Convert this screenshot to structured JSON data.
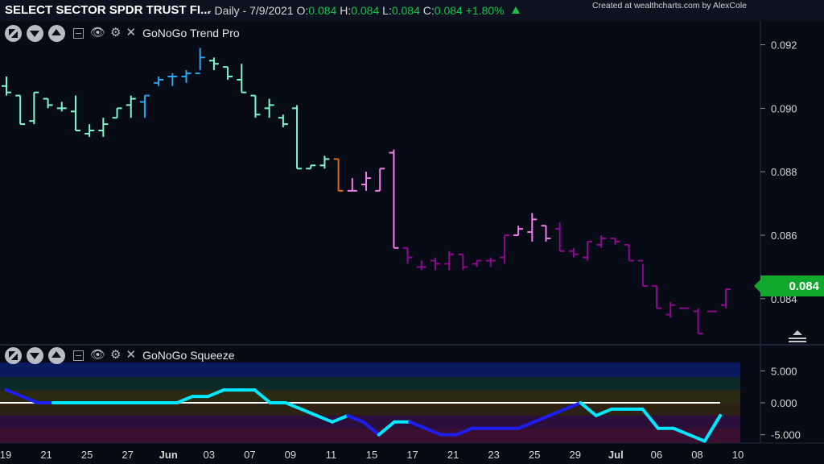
{
  "header": {
    "title": "SELECT SECTOR SPDR TRUST FI...",
    "meta": "- Daily - 7/9/2021",
    "open_label": "O:",
    "open": "0.084",
    "high_label": "H:",
    "high": "0.084",
    "low_label": "L:",
    "low": "0.084",
    "close_label": "C:",
    "close": "0.084",
    "change": "+1.80%",
    "credit": "Created at wealthcharts.com by AlexCole"
  },
  "panels": {
    "price_label": "GoNoGo Trend Pro",
    "oscillator_label": "GoNoGo Squeeze"
  },
  "last_price_tag": "0.084",
  "colors": {
    "go_strong": "#2aa6ee",
    "go": "#7ff7cf",
    "nogo": "#8c0a8f",
    "nogo_weak": "#f07de6",
    "neutral": "#d86a12",
    "squeeze_max": "#1e1ef0",
    "squeeze": "#00e8ff",
    "price_tag": "#11a82c",
    "background": "#070b15"
  },
  "chart_data": [
    {
      "type": "bar",
      "style": "ohlc",
      "title": "GoNoGo Trend Pro",
      "ylim": [
        0.0826,
        0.0927
      ],
      "yticks": [
        "0.092",
        "0.090",
        "0.088",
        "0.086",
        "0.084"
      ],
      "x_tick_labels": [
        "19",
        "21",
        "25",
        "27",
        "Jun",
        "03",
        "07",
        "09",
        "11",
        "15",
        "17",
        "21",
        "23",
        "25",
        "29",
        "Jul",
        "06",
        "08",
        "10"
      ],
      "grid": false,
      "ohlc": [
        {
          "o": 0.0907,
          "h": 0.091,
          "l": 0.0904,
          "c": 0.0905,
          "color": "go"
        },
        {
          "o": 0.0904,
          "h": 0.0904,
          "l": 0.0895,
          "c": 0.0895,
          "color": "go"
        },
        {
          "o": 0.0896,
          "h": 0.0905,
          "l": 0.0895,
          "c": 0.0905,
          "color": "go"
        },
        {
          "o": 0.0903,
          "h": 0.0903,
          "l": 0.09,
          "c": 0.0901,
          "color": "go"
        },
        {
          "o": 0.09,
          "h": 0.0902,
          "l": 0.0899,
          "c": 0.09,
          "color": "go"
        },
        {
          "o": 0.0899,
          "h": 0.0904,
          "l": 0.0893,
          "c": 0.0893,
          "color": "go"
        },
        {
          "o": 0.0892,
          "h": 0.0895,
          "l": 0.0891,
          "c": 0.0893,
          "color": "go"
        },
        {
          "o": 0.0893,
          "h": 0.0897,
          "l": 0.0891,
          "c": 0.0895,
          "color": "go"
        },
        {
          "o": 0.0897,
          "h": 0.09,
          "l": 0.0897,
          "c": 0.09,
          "color": "go"
        },
        {
          "o": 0.0901,
          "h": 0.0904,
          "l": 0.0897,
          "c": 0.0903,
          "color": "go"
        },
        {
          "o": 0.0902,
          "h": 0.0904,
          "l": 0.0897,
          "c": 0.0904,
          "color": "go_strong"
        },
        {
          "o": 0.0908,
          "h": 0.091,
          "l": 0.0907,
          "c": 0.0909,
          "color": "go_strong"
        },
        {
          "o": 0.091,
          "h": 0.0911,
          "l": 0.0907,
          "c": 0.091,
          "color": "go_strong"
        },
        {
          "o": 0.091,
          "h": 0.0912,
          "l": 0.0908,
          "c": 0.0911,
          "color": "go_strong"
        },
        {
          "o": 0.0911,
          "h": 0.0919,
          "l": 0.0912,
          "c": 0.0916,
          "color": "go_strong"
        },
        {
          "o": 0.0915,
          "h": 0.0916,
          "l": 0.0912,
          "c": 0.0914,
          "color": "go"
        },
        {
          "o": 0.0913,
          "h": 0.0913,
          "l": 0.0909,
          "c": 0.091,
          "color": "go"
        },
        {
          "o": 0.0909,
          "h": 0.0914,
          "l": 0.0905,
          "c": 0.0905,
          "color": "go"
        },
        {
          "o": 0.0904,
          "h": 0.0904,
          "l": 0.0897,
          "c": 0.0898,
          "color": "go"
        },
        {
          "o": 0.09,
          "h": 0.0903,
          "l": 0.0897,
          "c": 0.0901,
          "color": "go"
        },
        {
          "o": 0.0897,
          "h": 0.0898,
          "l": 0.0894,
          "c": 0.0895,
          "color": "go"
        },
        {
          "o": 0.09,
          "h": 0.0901,
          "l": 0.0881,
          "c": 0.0881,
          "color": "go"
        },
        {
          "o": 0.0881,
          "h": 0.0882,
          "l": 0.0881,
          "c": 0.0882,
          "color": "go"
        },
        {
          "o": 0.0882,
          "h": 0.0885,
          "l": 0.0881,
          "c": 0.0884,
          "color": "go"
        },
        {
          "o": 0.0884,
          "h": 0.0884,
          "l": 0.0874,
          "c": 0.0874,
          "color": "neutral"
        },
        {
          "o": 0.0874,
          "h": 0.0878,
          "l": 0.0874,
          "c": 0.0874,
          "color": "nogo_weak"
        },
        {
          "o": 0.0876,
          "h": 0.088,
          "l": 0.0874,
          "c": 0.0878,
          "color": "nogo_weak"
        },
        {
          "o": 0.0874,
          "h": 0.0881,
          "l": 0.0874,
          "c": 0.0881,
          "color": "nogo_weak"
        },
        {
          "o": 0.0886,
          "h": 0.0887,
          "l": 0.0856,
          "c": 0.0856,
          "color": "nogo_weak"
        },
        {
          "o": 0.0856,
          "h": 0.0856,
          "l": 0.0851,
          "c": 0.0853,
          "color": "nogo"
        },
        {
          "o": 0.085,
          "h": 0.0852,
          "l": 0.0849,
          "c": 0.085,
          "color": "nogo"
        },
        {
          "o": 0.0852,
          "h": 0.0853,
          "l": 0.0849,
          "c": 0.0851,
          "color": "nogo"
        },
        {
          "o": 0.0851,
          "h": 0.0855,
          "l": 0.0849,
          "c": 0.0854,
          "color": "nogo"
        },
        {
          "o": 0.0854,
          "h": 0.0854,
          "l": 0.0849,
          "c": 0.085,
          "color": "nogo"
        },
        {
          "o": 0.0851,
          "h": 0.0852,
          "l": 0.085,
          "c": 0.0852,
          "color": "nogo"
        },
        {
          "o": 0.0852,
          "h": 0.0853,
          "l": 0.085,
          "c": 0.0852,
          "color": "nogo"
        },
        {
          "o": 0.0853,
          "h": 0.086,
          "l": 0.0851,
          "c": 0.086,
          "color": "nogo"
        },
        {
          "o": 0.086,
          "h": 0.0863,
          "l": 0.086,
          "c": 0.0862,
          "color": "nogo_weak"
        },
        {
          "o": 0.0861,
          "h": 0.0867,
          "l": 0.0858,
          "c": 0.0865,
          "color": "nogo_weak"
        },
        {
          "o": 0.0863,
          "h": 0.0863,
          "l": 0.0858,
          "c": 0.0859,
          "color": "nogo_weak"
        },
        {
          "o": 0.0862,
          "h": 0.0864,
          "l": 0.0855,
          "c": 0.0855,
          "color": "nogo"
        },
        {
          "o": 0.0855,
          "h": 0.0856,
          "l": 0.0853,
          "c": 0.0854,
          "color": "nogo"
        },
        {
          "o": 0.0853,
          "h": 0.0858,
          "l": 0.0852,
          "c": 0.0858,
          "color": "nogo"
        },
        {
          "o": 0.0857,
          "h": 0.086,
          "l": 0.0856,
          "c": 0.0859,
          "color": "nogo"
        },
        {
          "o": 0.0859,
          "h": 0.0859,
          "l": 0.0857,
          "c": 0.0858,
          "color": "nogo"
        },
        {
          "o": 0.0857,
          "h": 0.0857,
          "l": 0.0852,
          "c": 0.0852,
          "color": "nogo"
        },
        {
          "o": 0.0852,
          "h": 0.0851,
          "l": 0.0844,
          "c": 0.0844,
          "color": "nogo"
        },
        {
          "o": 0.0844,
          "h": 0.0844,
          "l": 0.0837,
          "c": 0.0837,
          "color": "nogo"
        },
        {
          "o": 0.0835,
          "h": 0.0839,
          "l": 0.0834,
          "c": 0.0838,
          "color": "nogo"
        },
        {
          "o": 0.0837,
          "h": 0.0837,
          "l": 0.0837,
          "c": 0.0837,
          "color": "nogo"
        },
        {
          "o": 0.0836,
          "h": 0.0837,
          "l": 0.0829,
          "c": 0.0829,
          "color": "nogo"
        },
        {
          "o": 0.0836,
          "h": 0.0836,
          "l": 0.0836,
          "c": 0.0836,
          "color": "nogo"
        },
        {
          "o": 0.0838,
          "h": 0.0843,
          "l": 0.0837,
          "c": 0.0843,
          "color": "nogo"
        }
      ]
    },
    {
      "type": "line",
      "title": "GoNoGo Squeeze",
      "ylim": [
        -6.3,
        6.3
      ],
      "yticks": [
        "5.000",
        "0.000",
        "-5.000"
      ],
      "zero_line": 0,
      "series": [
        {
          "values": [
            2.0,
            1.0,
            0.0,
            0.0,
            0.0,
            0.0,
            0.0,
            0.0,
            0.0,
            0.0,
            0.0,
            0.0,
            1.0,
            1.0,
            2.0,
            2.0,
            2.0,
            0.0,
            0.0,
            -1.0,
            -2.0,
            -3.0,
            -2.0,
            -3.0,
            -5.0,
            -3.0,
            -3.0,
            -4.0,
            -5.0,
            -5.0,
            -4.0,
            -4.0,
            -4.0,
            -4.0,
            -3.0,
            -2.0,
            -1.0,
            0.0,
            -2.0,
            -1.0,
            -1.0,
            -1.0,
            -4.0,
            -4.0,
            -5.0,
            -6.0,
            -2.0
          ],
          "max_squeeze": [
            true,
            true,
            true,
            false,
            false,
            false,
            false,
            false,
            false,
            false,
            false,
            false,
            false,
            false,
            false,
            false,
            false,
            false,
            false,
            false,
            false,
            false,
            true,
            true,
            false,
            false,
            true,
            true,
            true,
            true,
            true,
            true,
            true,
            true,
            true,
            true,
            true,
            false,
            false,
            false,
            false,
            false,
            false,
            false,
            false,
            false,
            false
          ]
        }
      ]
    }
  ]
}
